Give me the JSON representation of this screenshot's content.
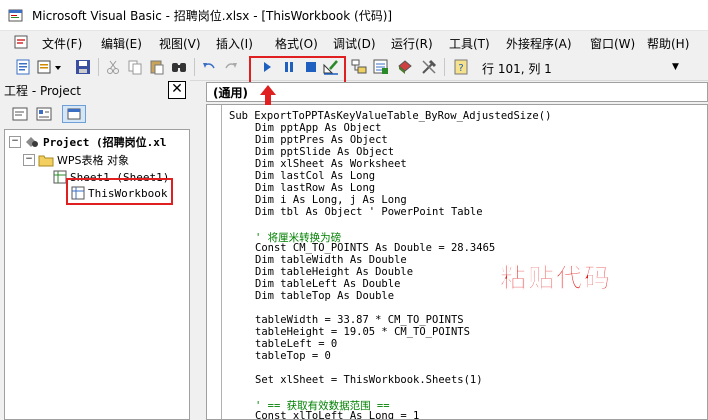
{
  "window": {
    "title": "Microsoft Visual Basic - 招聘岗位.xlsx - [ThisWorkbook (代码)]"
  },
  "menu": {
    "items": [
      {
        "label": "文件(F)"
      },
      {
        "label": "编辑(E)"
      },
      {
        "label": "视图(V)"
      },
      {
        "label": "插入(I)"
      },
      {
        "label": "格式(O)"
      },
      {
        "label": "调试(D)"
      },
      {
        "label": "运行(R)"
      },
      {
        "label": "工具(T)"
      },
      {
        "label": "外接程序(A)"
      },
      {
        "label": "窗口(W)"
      },
      {
        "label": "帮助(H)"
      }
    ]
  },
  "toolbar": {
    "position_text": "行 101, 列 1",
    "icons": [
      "excel-view-icon",
      "insert-module-icon",
      "save-icon",
      "cut-icon",
      "copy-icon",
      "paste-icon",
      "find-icon",
      "undo-icon",
      "redo-icon",
      "run-icon",
      "break-icon",
      "reset-icon",
      "design-mode-icon",
      "project-explorer-icon",
      "properties-icon",
      "object-browser-icon",
      "toolbox-icon",
      "help-icon"
    ]
  },
  "project": {
    "title": "工程 - Project",
    "close": "✕",
    "tree": {
      "root": "Project (招聘岗位.xl",
      "folder": "WPS表格 对象",
      "sheet1": "Sheet1 (Sheet1)",
      "workbook": "ThisWorkbook"
    }
  },
  "code": {
    "object_combo": "(通用)",
    "lines": [
      {
        "text": "Sub ExportToPPTAsKeyValueTable_ByRow_AdjustedSize()",
        "indent": 0
      },
      {
        "text": "Dim pptApp As Object",
        "indent": 1
      },
      {
        "text": "Dim pptPres As Object",
        "indent": 1
      },
      {
        "text": "Dim pptSlide As Object",
        "indent": 1
      },
      {
        "text": "Dim xlSheet As Worksheet",
        "indent": 1
      },
      {
        "text": "Dim lastCol As Long",
        "indent": 1
      },
      {
        "text": "Dim lastRow As Long",
        "indent": 1
      },
      {
        "text": "Dim i As Long, j As Long",
        "indent": 1
      },
      {
        "text": "Dim tbl As Object ' PowerPoint Table",
        "indent": 1
      },
      {
        "text": "",
        "indent": 1
      },
      {
        "text": "' 将厘米转换为磅",
        "indent": 1,
        "comment": true
      },
      {
        "text": "Const CM_TO_POINTS As Double = 28.3465",
        "indent": 1
      },
      {
        "text": "Dim tableWidth As Double",
        "indent": 1
      },
      {
        "text": "Dim tableHeight As Double",
        "indent": 1
      },
      {
        "text": "Dim tableLeft As Double",
        "indent": 1
      },
      {
        "text": "Dim tableTop As Double",
        "indent": 1
      },
      {
        "text": "",
        "indent": 1
      },
      {
        "text": "tableWidth = 33.87 * CM_TO_POINTS",
        "indent": 1
      },
      {
        "text": "tableHeight = 19.05 * CM_TO_POINTS",
        "indent": 1
      },
      {
        "text": "tableLeft = 0",
        "indent": 1
      },
      {
        "text": "tableTop = 0",
        "indent": 1
      },
      {
        "text": "",
        "indent": 1
      },
      {
        "text": "Set xlSheet = ThisWorkbook.Sheets(1)",
        "indent": 1
      },
      {
        "text": "",
        "indent": 1
      },
      {
        "text": "' == 获取有效数据范围 ==",
        "indent": 1,
        "comment": true
      },
      {
        "text": "Const xlToLeft As Long = 1",
        "indent": 1
      }
    ]
  },
  "annotation": {
    "text": "粘贴代码",
    "color": "#e01818"
  }
}
